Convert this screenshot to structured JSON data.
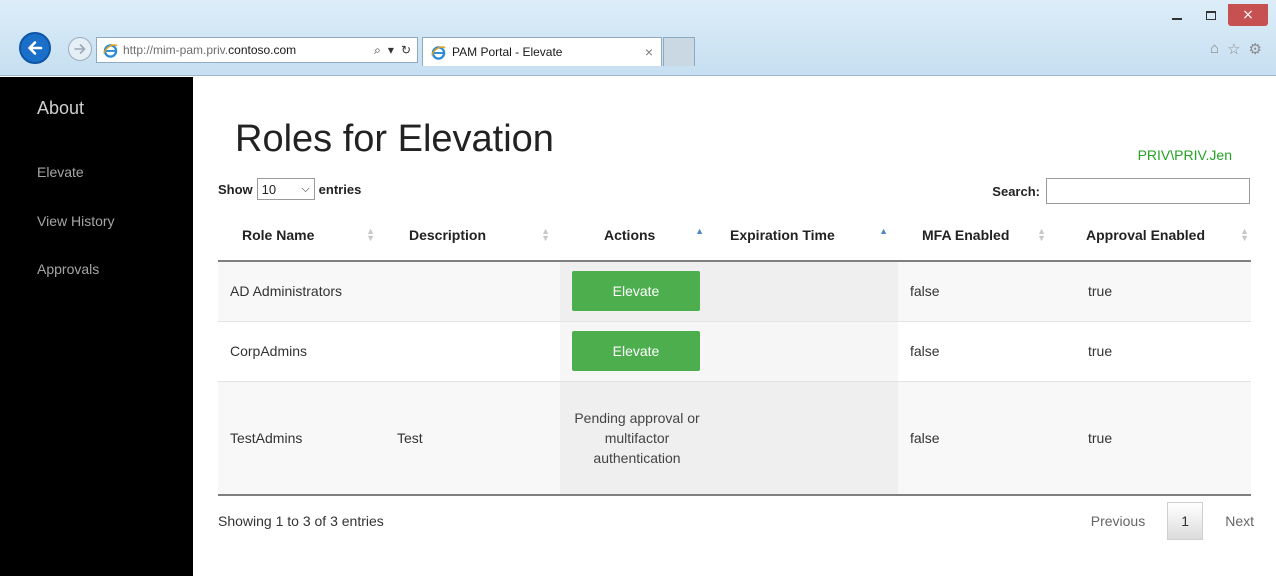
{
  "browser": {
    "address_prefix": "http://mim-pam.priv.",
    "address_domain": "contoso.com",
    "tab_title": "PAM Portal - Elevate",
    "window_controls": [
      "minimize-icon",
      "maximize-icon",
      "close-icon"
    ],
    "toolbar_icons": [
      "home-icon",
      "favorites-icon",
      "settings-icon"
    ]
  },
  "sidebar": {
    "brand": "About",
    "items": [
      {
        "label": "Elevate"
      },
      {
        "label": "View History"
      },
      {
        "label": "Approvals"
      }
    ]
  },
  "header": {
    "title": "Roles for Elevation",
    "user": "PRIV\\PRIV.Jen"
  },
  "controls": {
    "show_label": "Show",
    "entries_value": "10",
    "entries_label": "entries",
    "search_label": "Search:",
    "search_value": ""
  },
  "table": {
    "columns": [
      "Role Name",
      "Description",
      "Actions",
      "Expiration Time",
      "MFA Enabled",
      "Approval Enabled"
    ],
    "rows": [
      {
        "role": "AD Administrators",
        "description": "",
        "action": "Elevate",
        "expiration": "",
        "mfa": "false",
        "approval": "true"
      },
      {
        "role": "CorpAdmins",
        "description": "",
        "action": "Elevate",
        "expiration": "",
        "mfa": "false",
        "approval": "true"
      },
      {
        "role": "TestAdmins",
        "description": "Test",
        "action": "Pending approval or multifactor authentication",
        "expiration": "",
        "mfa": "false",
        "approval": "true"
      }
    ]
  },
  "footer": {
    "info": "Showing 1 to 3 of 3 entries",
    "previous": "Previous",
    "page": "1",
    "next": "Next"
  },
  "colors": {
    "accent_green": "#4cae4c",
    "user_green": "#25a225",
    "sidebar_bg": "#000000"
  }
}
